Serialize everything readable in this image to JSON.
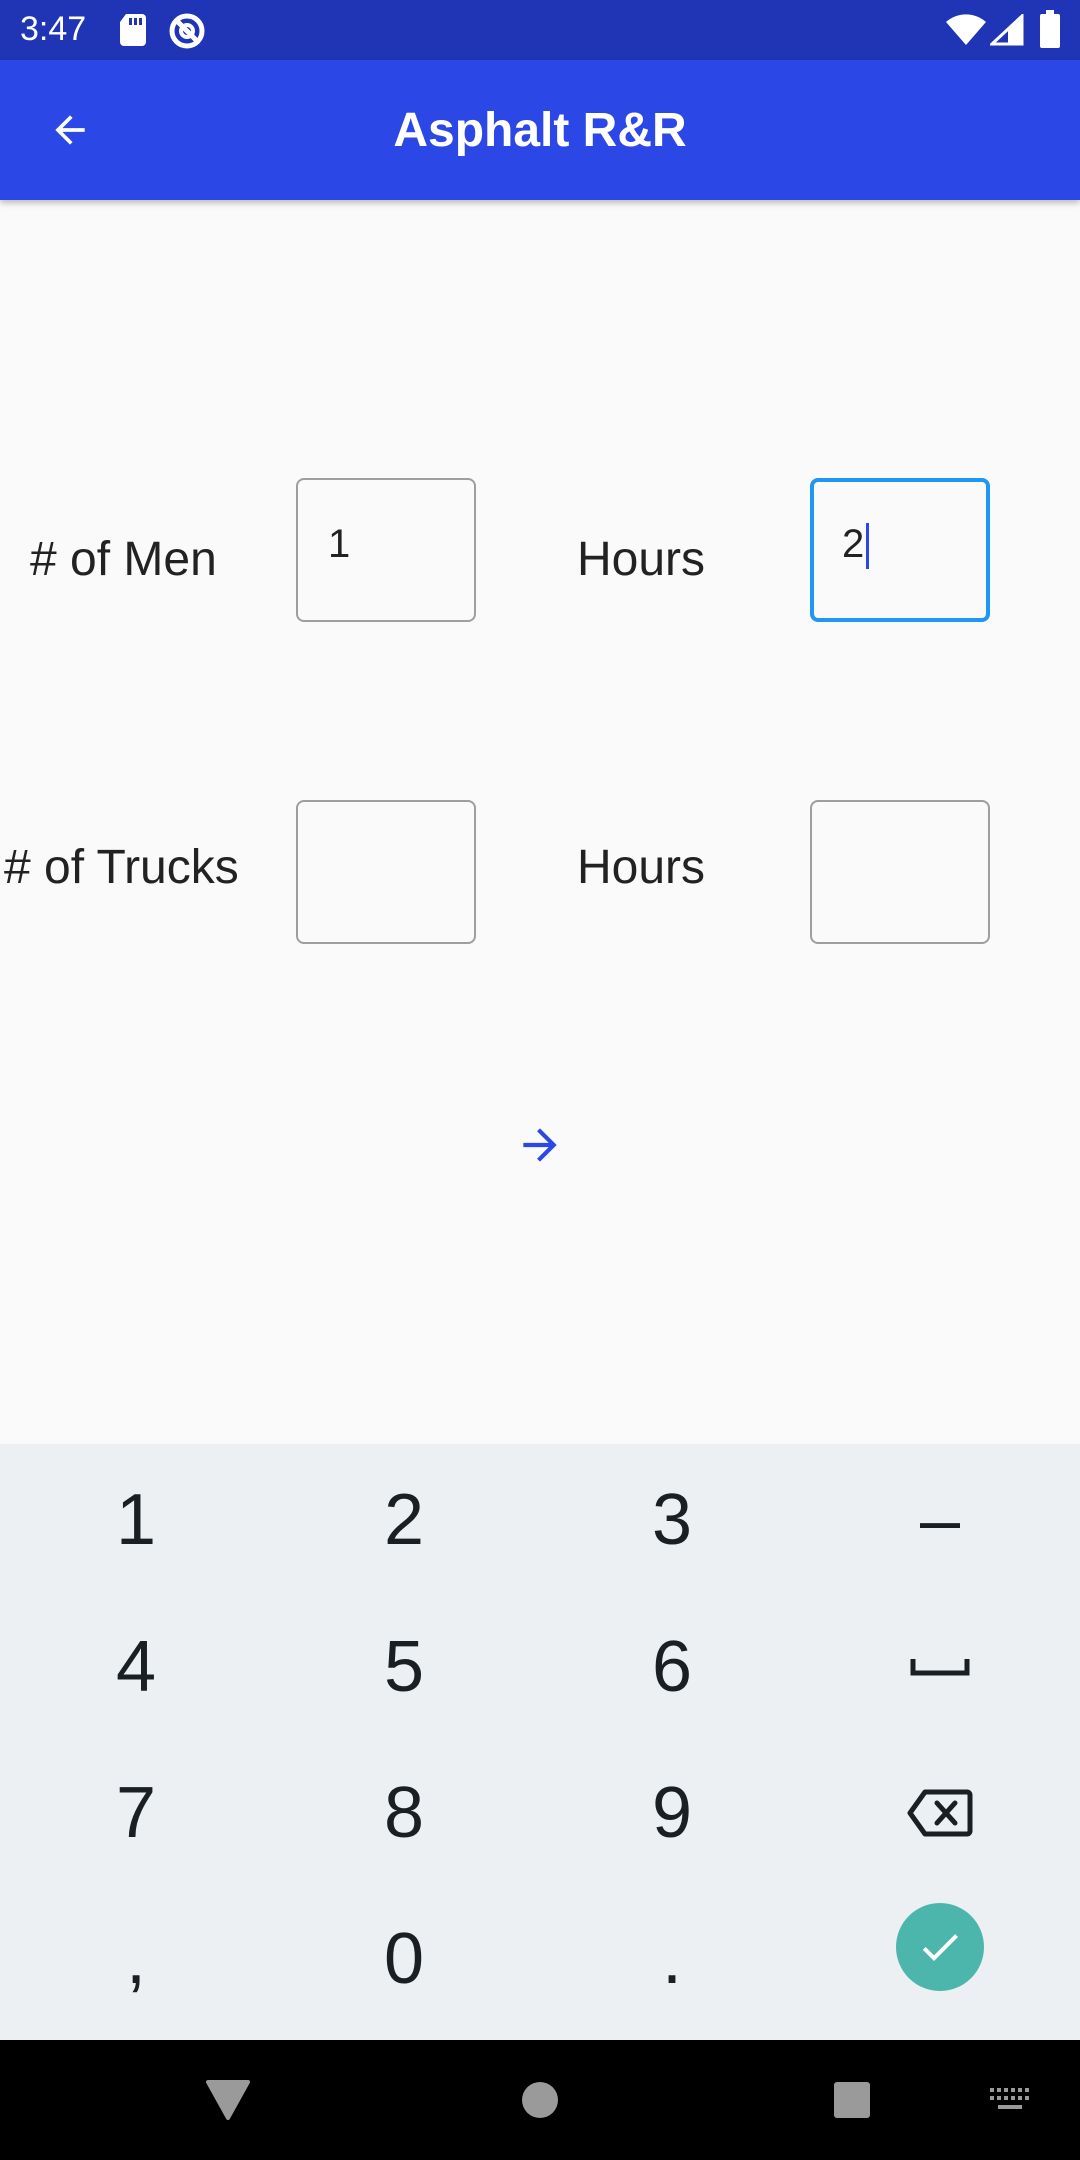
{
  "status_bar": {
    "time": "3:47",
    "icons": [
      "sd-card-icon",
      "sync-icon",
      "wifi-icon",
      "signal-icon",
      "battery-icon"
    ]
  },
  "app_bar": {
    "title": "Asphalt R&R",
    "back_icon": "arrow-left-icon"
  },
  "form": {
    "men_label": "# of Men",
    "men_value": "1",
    "men_hours_label": "Hours",
    "men_hours_value": "2",
    "trucks_label": "# of Trucks",
    "trucks_value": "",
    "trucks_hours_label": "Hours",
    "trucks_hours_value": "",
    "next_icon": "arrow-right-icon"
  },
  "keypad": {
    "keys": [
      "1",
      "2",
      "3",
      "–",
      "4",
      "5",
      "6",
      "␣",
      "7",
      "8",
      "9",
      "backspace",
      ",",
      "0",
      ".",
      "done"
    ]
  },
  "colors": {
    "status_bar": "#1f35b5",
    "app_bar": "#2b48e6",
    "focus_border": "#2196f3",
    "done_key": "#4db6ac",
    "keypad_bg": "#edf0f3"
  }
}
